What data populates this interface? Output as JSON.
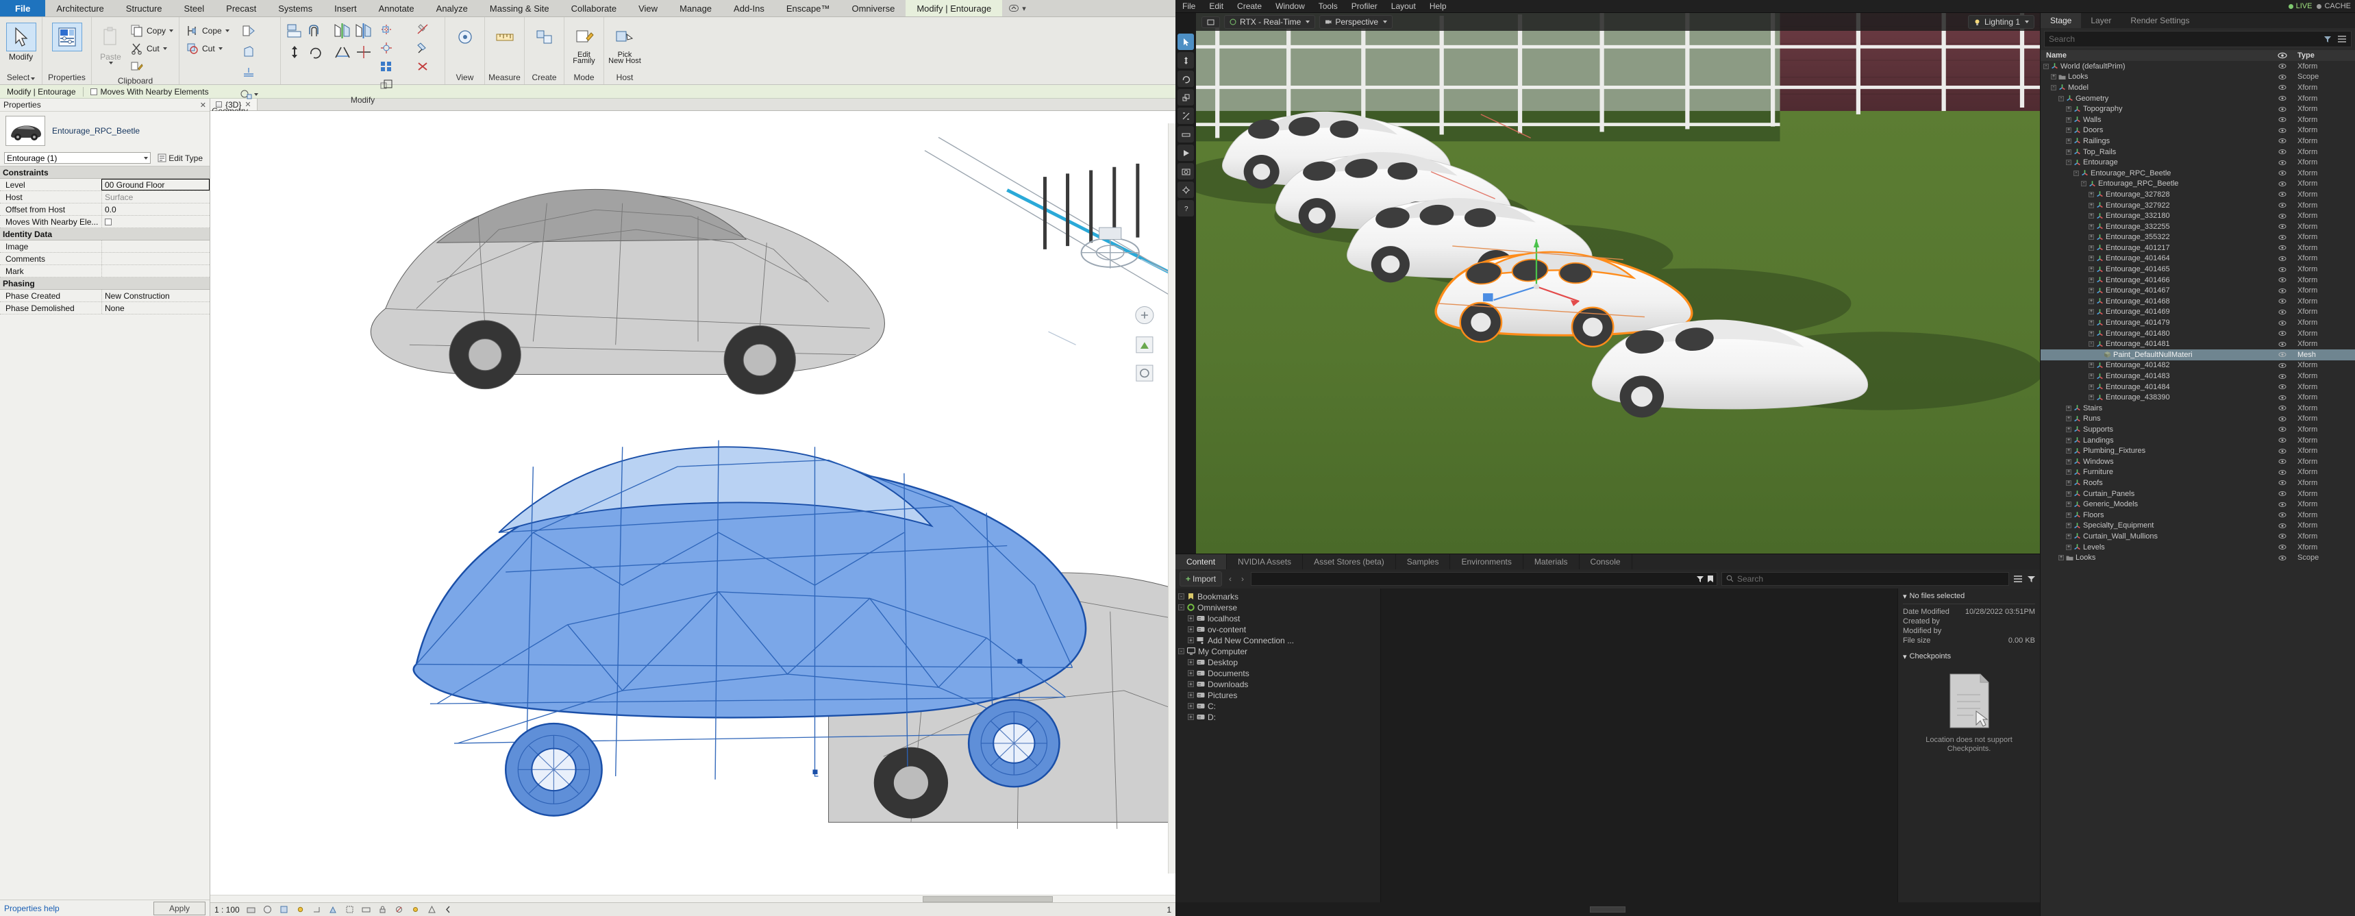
{
  "revit": {
    "ribbon_tabs": [
      {
        "label": "File",
        "kind": "file"
      },
      {
        "label": "Architecture",
        "kind": "normal"
      },
      {
        "label": "Structure",
        "kind": "normal"
      },
      {
        "label": "Steel",
        "kind": "normal"
      },
      {
        "label": "Precast",
        "kind": "normal"
      },
      {
        "label": "Systems",
        "kind": "normal"
      },
      {
        "label": "Insert",
        "kind": "normal"
      },
      {
        "label": "Annotate",
        "kind": "normal"
      },
      {
        "label": "Analyze",
        "kind": "normal"
      },
      {
        "label": "Massing & Site",
        "kind": "normal"
      },
      {
        "label": "Collaborate",
        "kind": "normal"
      },
      {
        "label": "View",
        "kind": "normal"
      },
      {
        "label": "Manage",
        "kind": "normal"
      },
      {
        "label": "Add-Ins",
        "kind": "normal"
      },
      {
        "label": "Enscape™",
        "kind": "normal"
      },
      {
        "label": "Omniverse",
        "kind": "normal"
      },
      {
        "label": "Modify | Entourage",
        "kind": "active"
      }
    ],
    "ribbon_panels": [
      {
        "label": "Select",
        "buttons": [
          {
            "caption": "Modify",
            "icon": "arrow-cursor-icon",
            "selected": true
          }
        ]
      },
      {
        "label": "Properties",
        "buttons": [
          {
            "caption": "Properties",
            "icon": "properties-panel-icon",
            "selected": true
          }
        ]
      },
      {
        "label": "Clipboard",
        "buttons": [
          {
            "caption": "Paste",
            "icon": "paste-icon",
            "disabled": true
          },
          {
            "caption": "Copy",
            "icon": "copy-icon"
          },
          {
            "caption": "Cut",
            "icon": "cut-icon"
          },
          {
            "caption": "Match Type Properties",
            "icon": "match-type-icon"
          }
        ]
      },
      {
        "label": "Geometry",
        "buttons": [
          {
            "caption": "Cope",
            "icon": "cope-icon"
          },
          {
            "caption": "Cut",
            "icon": "cut-geometry-icon"
          },
          {
            "caption": "Join",
            "icon": "join-icon"
          },
          {
            "caption": "Demolish",
            "icon": "demolish-icon"
          }
        ]
      },
      {
        "label": "Modify",
        "buttons": [
          {
            "caption": "Align",
            "icon": "align-icon"
          },
          {
            "caption": "Offset",
            "icon": "offset-icon"
          },
          {
            "caption": "Mirror - Pick Axis",
            "icon": "mirror-pick-axis-icon"
          },
          {
            "caption": "Mirror - Draw Axis",
            "icon": "mirror-draw-axis-icon"
          },
          {
            "caption": "Move",
            "icon": "move-icon"
          },
          {
            "caption": "Copy",
            "icon": "copy-modify-icon"
          },
          {
            "caption": "Rotate",
            "icon": "rotate-icon"
          },
          {
            "caption": "Trim/Extend",
            "icon": "trim-extend-icon"
          },
          {
            "caption": "Split",
            "icon": "split-icon"
          },
          {
            "caption": "Scale",
            "icon": "scale-icon"
          },
          {
            "caption": "Array",
            "icon": "array-icon"
          },
          {
            "caption": "Pin",
            "icon": "pin-icon"
          },
          {
            "caption": "Unpin",
            "icon": "unpin-icon"
          },
          {
            "caption": "Delete",
            "icon": "delete-icon"
          }
        ]
      },
      {
        "label": "View",
        "buttons": [
          {
            "caption": "View",
            "icon": "view-icon"
          }
        ]
      },
      {
        "label": "Measure",
        "buttons": [
          {
            "caption": "Measure",
            "icon": "measure-icon"
          }
        ]
      },
      {
        "label": "Create",
        "buttons": [
          {
            "caption": "Create",
            "icon": "create-group-icon"
          }
        ]
      },
      {
        "label": "Mode",
        "buttons": [
          {
            "caption": "Edit Family",
            "icon": "edit-family-icon"
          }
        ]
      },
      {
        "label": "Host",
        "buttons": [
          {
            "caption": "Pick New Host",
            "icon": "pick-new-host-icon"
          }
        ]
      }
    ],
    "context_panels": {
      "edit_family_caption": "Edit\nFamily",
      "pick_host_caption": "Pick\nNew Host"
    },
    "options_bar": {
      "context_label": "Modify | Entourage",
      "checkbox_label": "Moves With Nearby Elements",
      "checkbox_checked": false
    },
    "properties": {
      "panel_title": "Properties",
      "type_name": "Entourage_RPC_Beetle",
      "family_selector": "Entourage (1)",
      "edit_type_label": "Edit Type",
      "groups": [
        {
          "name": "Constraints",
          "rows": [
            {
              "name": "Level",
              "value": "00 Ground Floor",
              "style": "focus"
            },
            {
              "name": "Host",
              "value": "Surface",
              "style": "dim"
            },
            {
              "name": "Offset from Host",
              "value": "0.0",
              "style": "normal"
            },
            {
              "name": "Moves With Nearby Ele...",
              "value": "",
              "style": "checkbox"
            }
          ]
        },
        {
          "name": "Identity Data",
          "rows": [
            {
              "name": "Image",
              "value": "",
              "style": "normal"
            },
            {
              "name": "Comments",
              "value": "",
              "style": "normal"
            },
            {
              "name": "Mark",
              "value": "",
              "style": "normal"
            }
          ]
        },
        {
          "name": "Phasing",
          "rows": [
            {
              "name": "Phase Created",
              "value": "New Construction",
              "style": "normal"
            },
            {
              "name": "Phase Demolished",
              "value": "None",
              "style": "normal"
            }
          ]
        }
      ],
      "help_link": "Properties help",
      "apply_button": "Apply"
    },
    "view_tab": {
      "label": "{3D}",
      "close": "✕"
    },
    "status_bar": {
      "scale": "1 : 100",
      "selection_count": "1",
      "right_items": [
        "main-model-label"
      ]
    }
  },
  "omniverse": {
    "menubar": [
      "File",
      "Edit",
      "Create",
      "Window",
      "Tools",
      "Profiler",
      "Layout",
      "Help"
    ],
    "status_badges": [
      {
        "label": "LIVE",
        "kind": "live"
      },
      {
        "label": "CACHE",
        "kind": "cache"
      }
    ],
    "viewport": {
      "renderer_chip": "RTX - Real-Time",
      "camera_chip": "Perspective",
      "lighting_chip": "Lighting 1",
      "tools": [
        "select-tool",
        "move-tool",
        "rotate-tool",
        "scale-tool",
        "snap-tool",
        "measure-tool",
        "play-tool",
        "capture-tool",
        "settings-tool",
        "help-tool"
      ]
    },
    "content_tabs": [
      "Content",
      "NVIDIA Assets",
      "Asset Stores (beta)",
      "Samples",
      "Environments",
      "Materials",
      "Console"
    ],
    "content_active_tab": "Content",
    "content_toolbar": {
      "import_label": "Import",
      "back_icon": "chevron-left-icon",
      "forward_icon": "chevron-right-icon",
      "path_value": "",
      "search_placeholder": "Search"
    },
    "content_tree": [
      {
        "label": "Bookmarks",
        "depth": 0,
        "expander": "-",
        "icon": "bookmark-icon"
      },
      {
        "label": "Omniverse",
        "depth": 0,
        "expander": "-",
        "icon": "omniverse-icon"
      },
      {
        "label": "localhost",
        "depth": 1,
        "expander": "+",
        "icon": "server-icon"
      },
      {
        "label": "ov-content",
        "depth": 1,
        "expander": "+",
        "icon": "server-icon"
      },
      {
        "label": "Add New Connection ...",
        "depth": 1,
        "expander": "+",
        "icon": "add-connection-icon"
      },
      {
        "label": "My Computer",
        "depth": 0,
        "expander": "-",
        "icon": "computer-icon"
      },
      {
        "label": "Desktop",
        "depth": 1,
        "expander": "+",
        "icon": "drive-icon"
      },
      {
        "label": "Documents",
        "depth": 1,
        "expander": "+",
        "icon": "drive-icon"
      },
      {
        "label": "Downloads",
        "depth": 1,
        "expander": "+",
        "icon": "drive-icon"
      },
      {
        "label": "Pictures",
        "depth": 1,
        "expander": "+",
        "icon": "drive-icon"
      },
      {
        "label": "C:",
        "depth": 1,
        "expander": "+",
        "icon": "drive-icon"
      },
      {
        "label": "D:",
        "depth": 1,
        "expander": "+",
        "icon": "drive-icon"
      }
    ],
    "details": {
      "title": "No files selected",
      "rows": [
        {
          "key": "Date Modified",
          "value": "10/28/2022 03:51PM"
        },
        {
          "key": "Created by",
          "value": ""
        },
        {
          "key": "Modified by",
          "value": ""
        },
        {
          "key": "File size",
          "value": "0.00 KB"
        }
      ],
      "checkpoints_title": "Checkpoints",
      "checkpoints_empty": "Location does not support Checkpoints."
    },
    "stage": {
      "tabs": [
        "Stage",
        "Layer",
        "Render Settings"
      ],
      "active_tab": "Stage",
      "search_placeholder": "Search",
      "columns": {
        "name": "Name",
        "visibility": "eye-icon",
        "type": "Type"
      },
      "rows": [
        {
          "label": "World (defaultPrim)",
          "type": "Xform",
          "depth": 0,
          "expander": "-",
          "icon": "xform-icon"
        },
        {
          "label": "Looks",
          "type": "Scope",
          "depth": 1,
          "expander": "+",
          "icon": "folder-icon"
        },
        {
          "label": "Model",
          "type": "Xform",
          "depth": 1,
          "expander": "-",
          "icon": "xform-icon"
        },
        {
          "label": "Geometry",
          "type": "Xform",
          "depth": 2,
          "expander": "-",
          "icon": "xform-icon"
        },
        {
          "label": "Topography",
          "type": "Xform",
          "depth": 3,
          "expander": "+",
          "icon": "xform-icon"
        },
        {
          "label": "Walls",
          "type": "Xform",
          "depth": 3,
          "expander": "+",
          "icon": "xform-icon"
        },
        {
          "label": "Doors",
          "type": "Xform",
          "depth": 3,
          "expander": "+",
          "icon": "xform-icon"
        },
        {
          "label": "Railings",
          "type": "Xform",
          "depth": 3,
          "expander": "+",
          "icon": "xform-icon"
        },
        {
          "label": "Top_Rails",
          "type": "Xform",
          "depth": 3,
          "expander": "+",
          "icon": "xform-icon"
        },
        {
          "label": "Entourage",
          "type": "Xform",
          "depth": 3,
          "expander": "-",
          "icon": "xform-icon"
        },
        {
          "label": "Entourage_RPC_Beetle",
          "type": "Xform",
          "depth": 4,
          "expander": "-",
          "icon": "xform-icon"
        },
        {
          "label": "Entourage_RPC_Beetle",
          "type": "Xform",
          "depth": 5,
          "expander": "-",
          "icon": "xform-icon"
        },
        {
          "label": "Entourage_327828",
          "type": "Xform",
          "depth": 6,
          "expander": "+",
          "icon": "xform-icon"
        },
        {
          "label": "Entourage_327922",
          "type": "Xform",
          "depth": 6,
          "expander": "+",
          "icon": "xform-icon"
        },
        {
          "label": "Entourage_332180",
          "type": "Xform",
          "depth": 6,
          "expander": "+",
          "icon": "xform-icon"
        },
        {
          "label": "Entourage_332255",
          "type": "Xform",
          "depth": 6,
          "expander": "+",
          "icon": "xform-icon"
        },
        {
          "label": "Entourage_355322",
          "type": "Xform",
          "depth": 6,
          "expander": "+",
          "icon": "xform-icon"
        },
        {
          "label": "Entourage_401217",
          "type": "Xform",
          "depth": 6,
          "expander": "+",
          "icon": "xform-icon"
        },
        {
          "label": "Entourage_401464",
          "type": "Xform",
          "depth": 6,
          "expander": "+",
          "icon": "xform-icon"
        },
        {
          "label": "Entourage_401465",
          "type": "Xform",
          "depth": 6,
          "expander": "+",
          "icon": "xform-icon"
        },
        {
          "label": "Entourage_401466",
          "type": "Xform",
          "depth": 6,
          "expander": "+",
          "icon": "xform-icon"
        },
        {
          "label": "Entourage_401467",
          "type": "Xform",
          "depth": 6,
          "expander": "+",
          "icon": "xform-icon"
        },
        {
          "label": "Entourage_401468",
          "type": "Xform",
          "depth": 6,
          "expander": "+",
          "icon": "xform-icon"
        },
        {
          "label": "Entourage_401469",
          "type": "Xform",
          "depth": 6,
          "expander": "+",
          "icon": "xform-icon"
        },
        {
          "label": "Entourage_401479",
          "type": "Xform",
          "depth": 6,
          "expander": "+",
          "icon": "xform-icon"
        },
        {
          "label": "Entourage_401480",
          "type": "Xform",
          "depth": 6,
          "expander": "+",
          "icon": "xform-icon"
        },
        {
          "label": "Entourage_401481",
          "type": "Xform",
          "depth": 6,
          "expander": "-",
          "icon": "xform-icon"
        },
        {
          "label": "Paint_DefaultNullMateri",
          "type": "Mesh",
          "depth": 7,
          "expander": "",
          "icon": "mesh-icon",
          "selected": true
        },
        {
          "label": "Entourage_401482",
          "type": "Xform",
          "depth": 6,
          "expander": "+",
          "icon": "xform-icon"
        },
        {
          "label": "Entourage_401483",
          "type": "Xform",
          "depth": 6,
          "expander": "+",
          "icon": "xform-icon"
        },
        {
          "label": "Entourage_401484",
          "type": "Xform",
          "depth": 6,
          "expander": "+",
          "icon": "xform-icon"
        },
        {
          "label": "Entourage_438390",
          "type": "Xform",
          "depth": 6,
          "expander": "+",
          "icon": "xform-icon"
        },
        {
          "label": "Stairs",
          "type": "Xform",
          "depth": 3,
          "expander": "+",
          "icon": "xform-icon"
        },
        {
          "label": "Runs",
          "type": "Xform",
          "depth": 3,
          "expander": "+",
          "icon": "xform-icon"
        },
        {
          "label": "Supports",
          "type": "Xform",
          "depth": 3,
          "expander": "+",
          "icon": "xform-icon"
        },
        {
          "label": "Landings",
          "type": "Xform",
          "depth": 3,
          "expander": "+",
          "icon": "xform-icon"
        },
        {
          "label": "Plumbing_Fixtures",
          "type": "Xform",
          "depth": 3,
          "expander": "+",
          "icon": "xform-icon"
        },
        {
          "label": "Windows",
          "type": "Xform",
          "depth": 3,
          "expander": "+",
          "icon": "xform-icon"
        },
        {
          "label": "Furniture",
          "type": "Xform",
          "depth": 3,
          "expander": "+",
          "icon": "xform-icon"
        },
        {
          "label": "Roofs",
          "type": "Xform",
          "depth": 3,
          "expander": "+",
          "icon": "xform-icon"
        },
        {
          "label": "Curtain_Panels",
          "type": "Xform",
          "depth": 3,
          "expander": "+",
          "icon": "xform-icon"
        },
        {
          "label": "Generic_Models",
          "type": "Xform",
          "depth": 3,
          "expander": "+",
          "icon": "xform-icon"
        },
        {
          "label": "Floors",
          "type": "Xform",
          "depth": 3,
          "expander": "+",
          "icon": "xform-icon"
        },
        {
          "label": "Specialty_Equipment",
          "type": "Xform",
          "depth": 3,
          "expander": "+",
          "icon": "xform-icon"
        },
        {
          "label": "Curtain_Wall_Mullions",
          "type": "Xform",
          "depth": 3,
          "expander": "+",
          "icon": "xform-icon"
        },
        {
          "label": "Levels",
          "type": "Xform",
          "depth": 3,
          "expander": "+",
          "icon": "xform-icon"
        },
        {
          "label": "Looks",
          "type": "Scope",
          "depth": 2,
          "expander": "+",
          "icon": "folder-icon"
        }
      ]
    }
  },
  "colors": {
    "revit_accent": "#1e73be",
    "revit_context_green": "#e7efdc",
    "selection_blue": "#2f6fd0",
    "omni_selection": "#6f8590",
    "omni_bg": "#1f1f1f",
    "grass": "#4e6b2d",
    "highlight_orange": "#ff8c1a"
  }
}
